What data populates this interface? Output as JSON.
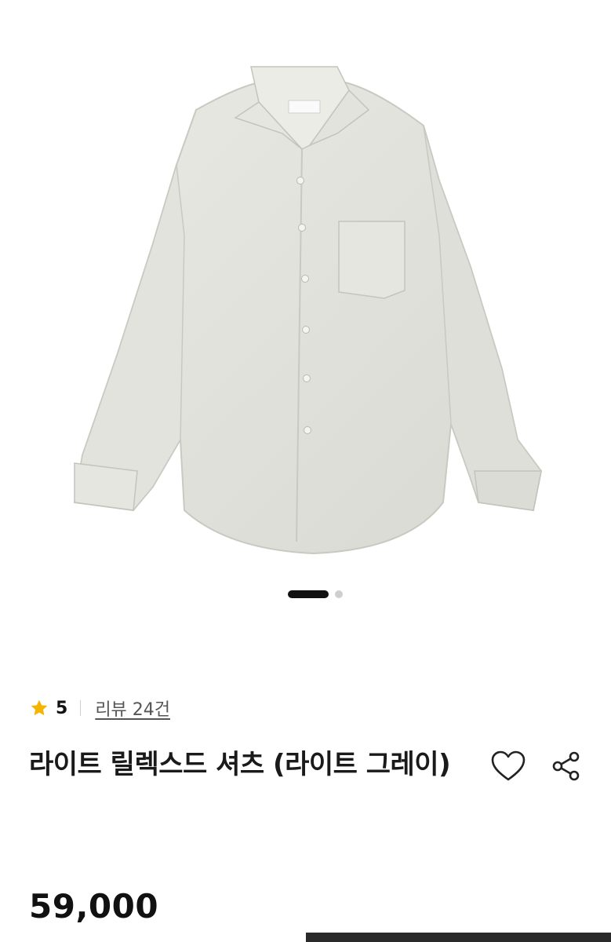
{
  "product": {
    "image_alt": "라이트 그레이 셔츠",
    "rating": "5",
    "review_link": "리뷰 24건",
    "title": "라이트 릴렉스드 셔츠 (라이트 그레이)",
    "price": "59,000"
  },
  "gallery": {
    "total_pages": 2,
    "active_page": 1
  },
  "icons": {
    "rating": "star-icon",
    "like": "heart-icon",
    "share": "share-icon"
  },
  "colors": {
    "star": "#F5B400",
    "shirt": "#E2E2DC",
    "text": "#1A1A1A"
  }
}
